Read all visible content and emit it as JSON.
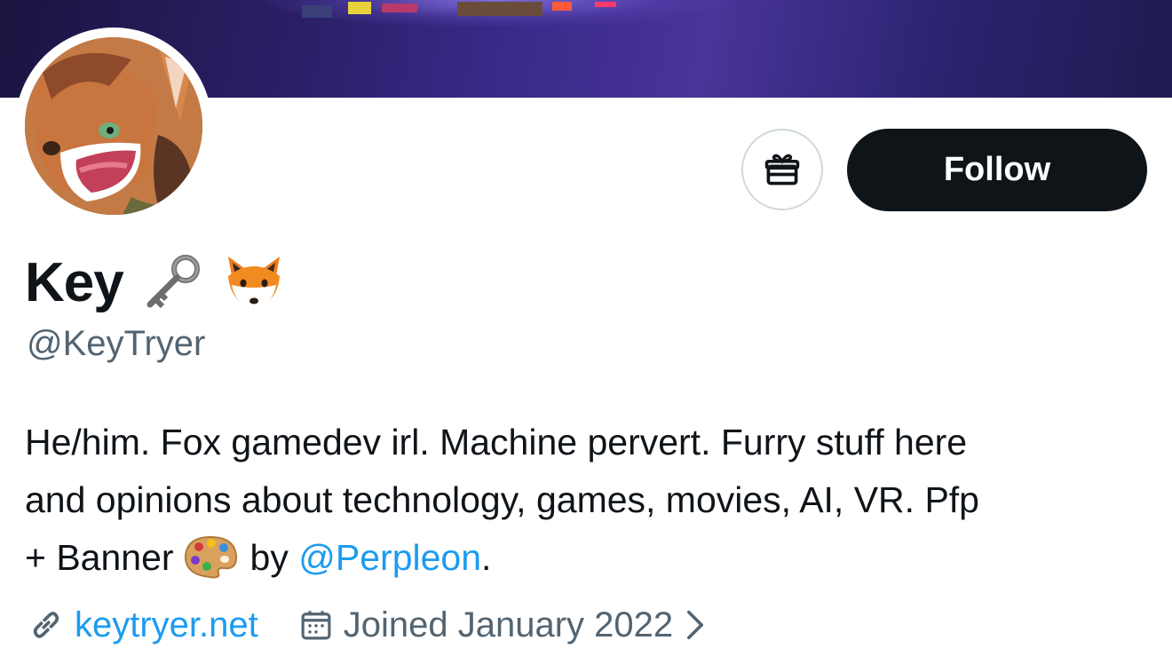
{
  "profile": {
    "display_name": "Key",
    "name_emojis": [
      "key-emoji",
      "fox-emoji"
    ],
    "handle": "@KeyTryer",
    "bio": {
      "line1": "He/him. Fox gamedev irl. Machine pervert. Furry stuff here",
      "line2": "and opinions about technology, games, movies, AI, VR. Pfp",
      "line3_prefix": "+ Banner",
      "line3_by": "by",
      "mention": "@Perpleon",
      "line3_suffix": "."
    },
    "website": "keytryer.net",
    "joined": "Joined January 2022"
  },
  "actions": {
    "follow_label": "Follow",
    "gift_icon": "gift-icon"
  },
  "icons": {
    "link": "link-icon",
    "calendar": "calendar-icon",
    "chevron": "chevron-right-icon"
  },
  "colors": {
    "text": "#0f1419",
    "secondary": "#536471",
    "link": "#1d9bf0",
    "follow_bg": "#0f1419",
    "border": "#cfd9de"
  }
}
